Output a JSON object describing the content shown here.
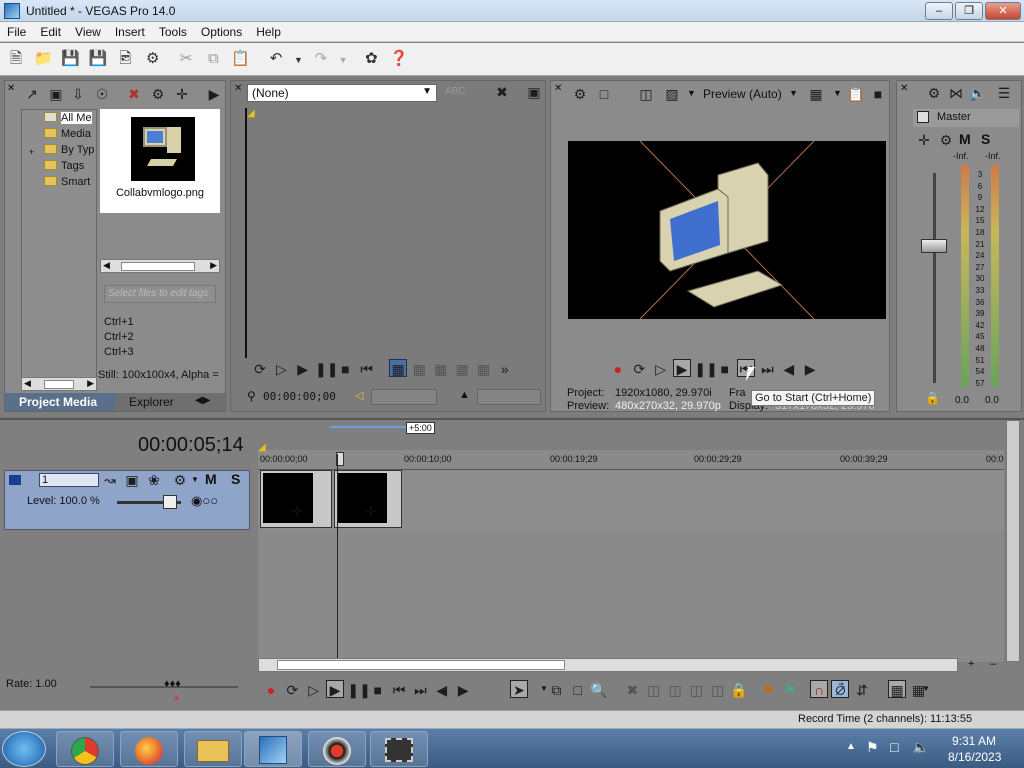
{
  "window": {
    "title": "Untitled * - VEGAS Pro 14.0"
  },
  "menu": [
    "File",
    "Edit",
    "View",
    "Insert",
    "Tools",
    "Options",
    "Help"
  ],
  "media": {
    "tree": [
      "All Me",
      "Media",
      "By Typ",
      "Tags",
      "Smart"
    ],
    "file_name": "Collabvmlogo.png",
    "tags_placeholder": "Select files to edit tags",
    "shortcuts": [
      "Ctrl+1",
      "Ctrl+2",
      "Ctrl+3"
    ],
    "info": "Still: 100x100x4, Alpha =",
    "tabs": [
      "Project Media",
      "Explorer"
    ]
  },
  "trimmer": {
    "dropdown": "(None)",
    "timecode": "00:00:00;00"
  },
  "preview": {
    "mode": "Preview (Auto)",
    "project_label": "Project:",
    "project_value": "1920x1080, 29.970i",
    "preview_label": "Preview:",
    "preview_value": "480x270x32, 29.970p",
    "frame_label": "Fra",
    "display_label": "Display:",
    "display_value": "317x178x32, 29.970",
    "tooltip": "Go to Start (Ctrl+Home)"
  },
  "master": {
    "title": "Master",
    "m": "M",
    "s": "S",
    "inf_left": "-Inf.",
    "inf_right": "-Inf.",
    "scale": [
      "3",
      "6",
      "9",
      "12",
      "15",
      "18",
      "21",
      "24",
      "27",
      "30",
      "33",
      "36",
      "39",
      "42",
      "45",
      "48",
      "51",
      "54",
      "57"
    ],
    "bottom_left": "0.0",
    "bottom_right": "0.0"
  },
  "timeline": {
    "time": "00:00:05;14",
    "offset": "+5:00",
    "ruler": [
      "00:00:00;00",
      "00:00:10;00",
      "00:00:19;29",
      "00:00:29;29",
      "00:00:39;29",
      "00:0"
    ],
    "track_num": "1",
    "level": "Level: 100.0 %",
    "m": "M",
    "s": "S",
    "rate": "Rate: 1.00",
    "record_time": "Record Time (2 channels): 11:13:55"
  },
  "taskbar": {
    "time": "9:31 AM",
    "date": "8/16/2023"
  },
  "colors": {
    "accent": "#1a3d8f",
    "panel": "#8b8b8b"
  }
}
